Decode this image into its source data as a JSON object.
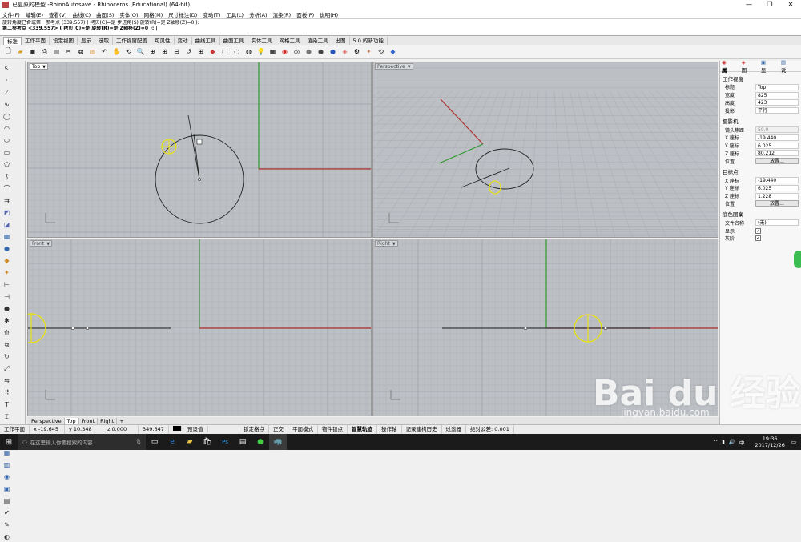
{
  "window": {
    "title": "已复原的模型 -RhinoAutosave - Rhinoceros (Educational) (64-bit)",
    "controls": [
      "—",
      "❐",
      "✕"
    ]
  },
  "menu": [
    "文件(F)",
    "编辑(E)",
    "查看(V)",
    "曲线(C)",
    "曲面(S)",
    "实体(O)",
    "网格(M)",
    "尺寸标注(D)",
    "变动(T)",
    "工具(L)",
    "分析(A)",
    "渲染(R)",
    "面板(P)",
    "说明(H)"
  ],
  "command": {
    "line1": "旋转角度已合或第一参考点 (339.557) ( 拷贝(C)=是 步进角(S) 旋转(R)=是 Z轴移(Z)=0 ):",
    "line2": "第二参考点 <339.557> ( 拷贝(C)=是 旋转(R)=是 Z轴移(Z)=0 ): |"
  },
  "toolbar_tabs": [
    "标准",
    "工作平面",
    "设定视图",
    "显示",
    "选取",
    "工作视窗配置",
    "可见性",
    "变动",
    "曲线工具",
    "曲面工具",
    "实体工具",
    "网格工具",
    "渲染工具",
    "出图",
    "5.0 的新功能"
  ],
  "viewports": {
    "top": "Top",
    "perspective": "Perspective",
    "front": "Front",
    "right": "Right"
  },
  "viewport_tabs": [
    "Perspective",
    "Top",
    "Front",
    "Right",
    "+"
  ],
  "panel": {
    "tabs": [
      "属",
      "图",
      "显",
      "说"
    ],
    "section_viewport": "工作视窗",
    "rows_viewport": [
      {
        "k": "标题",
        "v": "Top"
      },
      {
        "k": "宽度",
        "v": "825"
      },
      {
        "k": "高度",
        "v": "423"
      },
      {
        "k": "投影",
        "v": "平行"
      }
    ],
    "section_camera": "摄影机",
    "rows_camera": [
      {
        "k": "镜头焦距",
        "v": "50.0"
      },
      {
        "k": "X 座标",
        "v": "-19.440"
      },
      {
        "k": "Y 座标",
        "v": "6.025"
      },
      {
        "k": "Z 座标",
        "v": "80.212"
      },
      {
        "k": "位置",
        "v": "放置..."
      }
    ],
    "section_target": "目标点",
    "rows_target": [
      {
        "k": "X 座标",
        "v": "-19.440"
      },
      {
        "k": "Y 座标",
        "v": "6.025"
      },
      {
        "k": "Z 座标",
        "v": "1.228"
      },
      {
        "k": "位置",
        "v": "放置..."
      }
    ],
    "section_wallpaper": "底色图案",
    "rows_wallpaper": [
      {
        "k": "文件名称",
        "v": "(无)"
      },
      {
        "k": "显示",
        "v": "✓"
      },
      {
        "k": "灰阶",
        "v": "✓"
      }
    ]
  },
  "status": {
    "cplane": "工作平面",
    "x": "x -19.645",
    "y": "y 10.348",
    "z": "z 0.000",
    "dist": "349.647",
    "layer": "预设值",
    "items": [
      "锁定格点",
      "正交",
      "平面模式",
      "物件锁点",
      "智慧轨迹",
      "操作轴",
      "记录建构历史",
      "过滤器",
      "绝对公差: 0.001"
    ]
  },
  "taskbar": {
    "search_placeholder": "在这里输入你要搜索的内容",
    "time": "19:36",
    "date": "2017/12/26"
  },
  "watermark": {
    "logo": "Bai du 经验",
    "url": "jingyan.baidu.com"
  },
  "colors": {
    "x_axis": "#b03030",
    "y_axis": "#2f9a2f",
    "selection": "#e8e01a"
  }
}
